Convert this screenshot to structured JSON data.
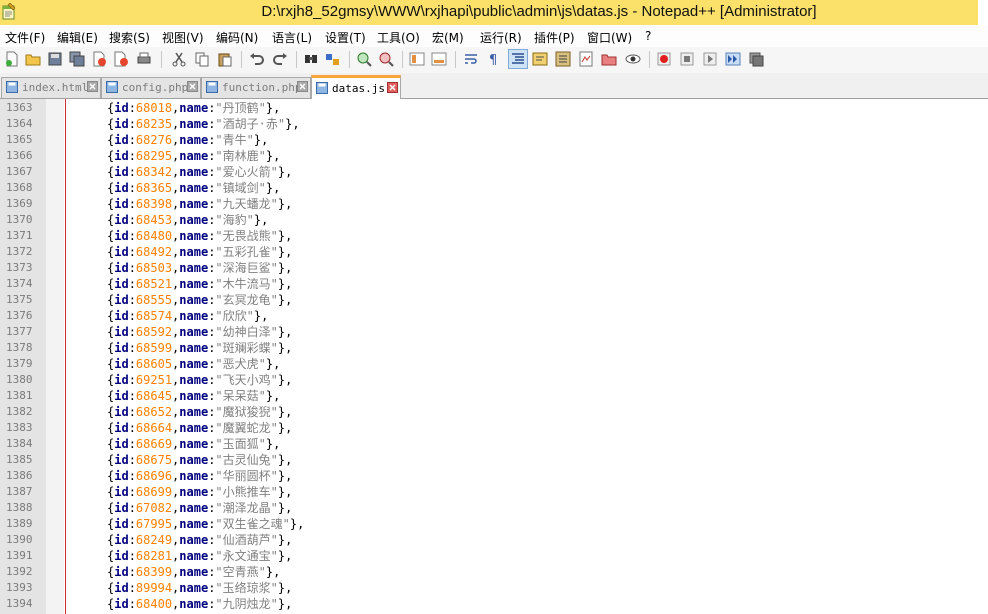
{
  "window": {
    "title": "D:\\rxjh8_52gmsy\\WWW\\rxjhapi\\public\\admin\\js\\datas.js - Notepad++ [Administrator]"
  },
  "menu": [
    "文件(F)",
    "编辑(E)",
    "搜索(S)",
    "视图(V)",
    "编码(N)",
    "语言(L)",
    "设置(T)",
    "工具(O)",
    "宏(M)",
    "运行(R)",
    "插件(P)",
    "窗口(W)",
    "?"
  ],
  "toolbar_icons": [
    "new-file-icon",
    "open-file-icon",
    "save-icon",
    "save-all-icon",
    "close-icon",
    "close-all-icon",
    "print-icon",
    "cut-icon",
    "copy-icon",
    "paste-icon",
    "undo-icon",
    "redo-icon",
    "find-icon",
    "replace-icon",
    "zoom-in-icon",
    "zoom-out-icon",
    "sync-vertical-icon",
    "sync-horizontal-icon",
    "word-wrap-icon",
    "show-all-chars-icon",
    "indent-guide-icon",
    "language-icon",
    "function-list-icon",
    "document-map-icon",
    "folder-workspace-icon",
    "monitor-icon",
    "record-macro-icon",
    "stop-macro-icon",
    "play-macro-icon",
    "run-macro-multiple-icon",
    "save-macro-icon"
  ],
  "tabs": [
    {
      "label": "index.html",
      "active": false
    },
    {
      "label": "config.php",
      "active": false
    },
    {
      "label": "function.php",
      "active": false
    },
    {
      "label": "datas.js",
      "active": true
    }
  ],
  "editor": {
    "lines": [
      {
        "num": "1363",
        "id": "68018",
        "name": "丹顶鹤",
        "tail": "},"
      },
      {
        "num": "1364",
        "id": "68235",
        "name": "酒胡子·赤",
        "tail": "},"
      },
      {
        "num": "1365",
        "id": "68276",
        "name": "青牛",
        "tail": "},"
      },
      {
        "num": "1366",
        "id": "68295",
        "name": "南林鹿",
        "tail": "},"
      },
      {
        "num": "1367",
        "id": "68342",
        "name": "爱心火箭",
        "tail": "},"
      },
      {
        "num": "1368",
        "id": "68365",
        "name": "镇域剑",
        "tail": "},"
      },
      {
        "num": "1369",
        "id": "68398",
        "name": "九天蟠龙",
        "tail": "},"
      },
      {
        "num": "1370",
        "id": "68453",
        "name": "海豹",
        "tail": "},"
      },
      {
        "num": "1371",
        "id": "68480",
        "name": "无畏战熊",
        "tail": "},"
      },
      {
        "num": "1372",
        "id": "68492",
        "name": "五彩孔雀",
        "tail": "},"
      },
      {
        "num": "1373",
        "id": "68503",
        "name": "深海巨鲨",
        "tail": "},"
      },
      {
        "num": "1374",
        "id": "68521",
        "name": "木牛流马",
        "tail": "},"
      },
      {
        "num": "1375",
        "id": "68555",
        "name": "玄冥龙龟",
        "tail": "},"
      },
      {
        "num": "1376",
        "id": "68574",
        "name": "欣欣",
        "tail": "},"
      },
      {
        "num": "1377",
        "id": "68592",
        "name": "幼神白泽",
        "tail": "},"
      },
      {
        "num": "1378",
        "id": "68599",
        "name": "斑斓彩蝶",
        "tail": "},"
      },
      {
        "num": "1379",
        "id": "68605",
        "name": "恶犬虎",
        "tail": "},"
      },
      {
        "num": "1380",
        "id": "69251",
        "name": "飞天小鸡",
        "tail": "},"
      },
      {
        "num": "1381",
        "id": "68645",
        "name": "呆呆菇",
        "tail": "},"
      },
      {
        "num": "1382",
        "id": "68652",
        "name": "魔狱狻猊",
        "tail": "},"
      },
      {
        "num": "1383",
        "id": "68664",
        "name": "魔翼蛇龙",
        "tail": "},"
      },
      {
        "num": "1384",
        "id": "68669",
        "name": "玉面狐",
        "tail": "},"
      },
      {
        "num": "1385",
        "id": "68675",
        "name": "古灵仙兔",
        "tail": "},"
      },
      {
        "num": "1386",
        "id": "68696",
        "name": "华丽圆杯",
        "tail": "},"
      },
      {
        "num": "1387",
        "id": "68699",
        "name": "小熊推车",
        "tail": "},"
      },
      {
        "num": "1388",
        "id": "67082",
        "name": "潮泽龙晶",
        "tail": "},"
      },
      {
        "num": "1389",
        "id": "67995",
        "name": "双生雀之魂",
        "tail": "},"
      },
      {
        "num": "1390",
        "id": "68249",
        "name": "仙酒葫芦",
        "tail": "},"
      },
      {
        "num": "1391",
        "id": "68281",
        "name": "永文通宝",
        "tail": "},"
      },
      {
        "num": "1392",
        "id": "68399",
        "name": "空青燕",
        "tail": "},"
      },
      {
        "num": "1393",
        "id": "89994",
        "name": "玉络琼浆",
        "tail": "},"
      },
      {
        "num": "1394",
        "id": "68400",
        "name": "九阴烛龙",
        "tail": "},"
      }
    ]
  },
  "colors": {
    "title_bar": "#fbe16a",
    "keyword": "#000080",
    "number": "#ff8000",
    "string": "#808080",
    "fold_line": "#d2303d",
    "active_tab_accent": "#f9a53b"
  }
}
